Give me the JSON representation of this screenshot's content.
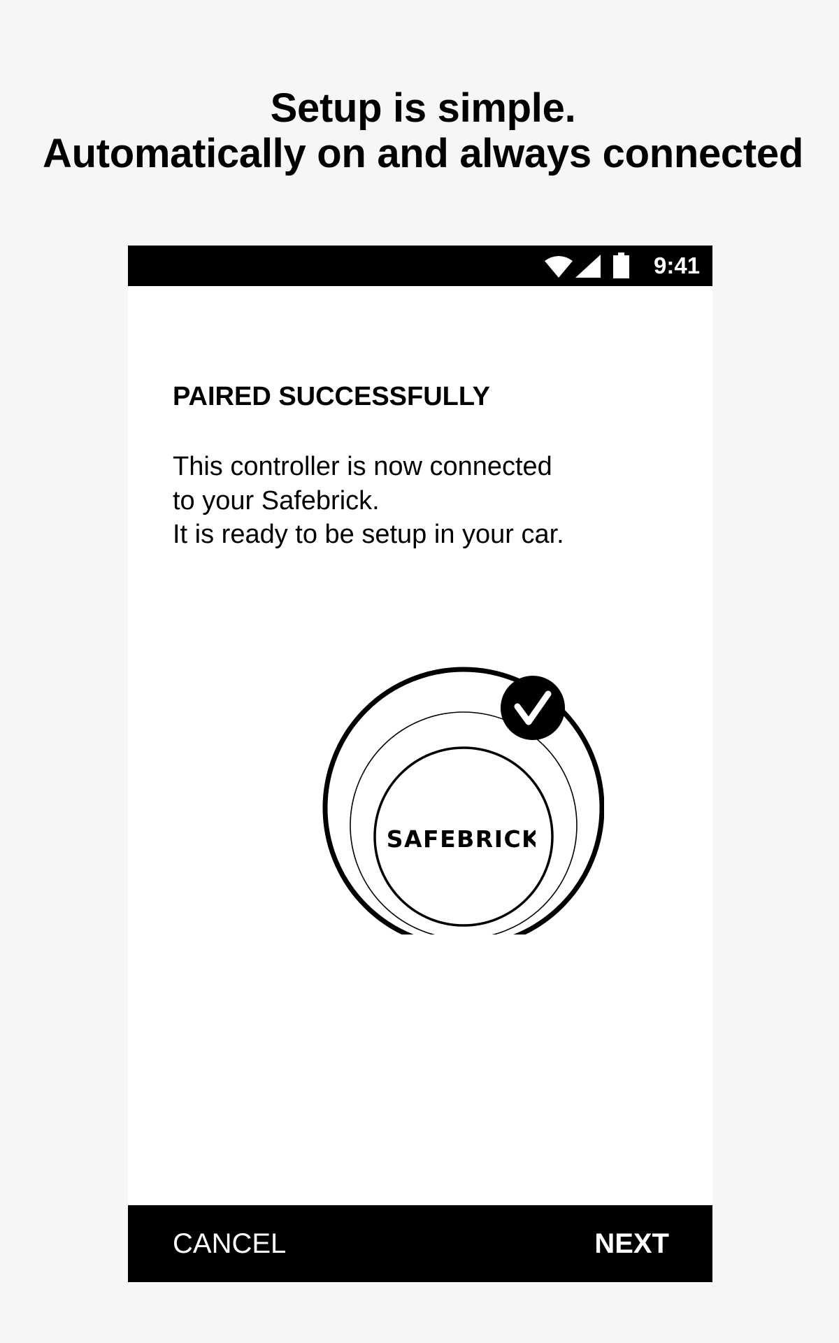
{
  "headline": {
    "line1": "Setup is simple.",
    "line2": "Automatically on and always connected"
  },
  "status_bar": {
    "time": "9:41",
    "icons": [
      "wifi-icon",
      "signal-icon",
      "battery-icon"
    ]
  },
  "screen": {
    "title": "PAIRED SUCCESSFULLY",
    "body_line1": "This controller is now connected",
    "body_line2": "to your Safebrick.",
    "body_line3": "It is ready to be setup in your car.",
    "device_label": "SAFEBRICK",
    "badge_icon": "checkmark-icon"
  },
  "bottom_bar": {
    "cancel_label": "CANCEL",
    "next_label": "NEXT"
  },
  "colors": {
    "page_background": "#f6f6f6",
    "screen_background": "#ffffff",
    "bar_background": "#000000",
    "bar_text": "#ffffff"
  }
}
